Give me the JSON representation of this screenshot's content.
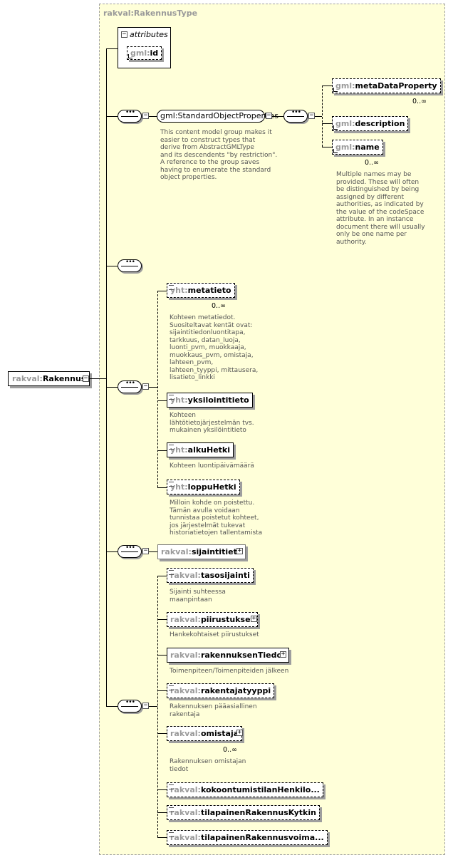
{
  "type_name": "rakval:RakennusType",
  "root": {
    "prefix": "rakval:",
    "name": "Rakennus"
  },
  "attributes": {
    "header": "attributes",
    "id": {
      "prefix": "gml:",
      "name": "id"
    }
  },
  "std_group": {
    "name": "gml:StandardObjectProperties",
    "note": [
      "This content model group makes it",
      "easier to construct types that",
      "    derive from AbstractGMLType",
      "and its descendents \"by restriction\".",
      "    A reference to the group saves",
      "having to enumerate the standard",
      "object properties."
    ],
    "items": [
      {
        "prefix": "gml:",
        "name": "metaDataProperty",
        "card": "0..∞"
      },
      {
        "prefix": "gml:",
        "name": "description",
        "card": ""
      },
      {
        "prefix": "gml:",
        "name": "name",
        "card": "0..∞"
      }
    ],
    "name_note": [
      "Multiple names may be",
      "provided.  These will often",
      "be distinguished by being",
      "assigned by different",
      "authorities, as indicated by",
      "the value of the codeSpace",
      "attribute.  In an instance",
      "document there will usually",
      "only be one name per",
      "authority."
    ]
  },
  "yht": [
    {
      "prefix": "yht:",
      "name": "metatieto",
      "card": "0..∞",
      "note": [
        "Kohteen metatiedot.",
        "Suositeltavat kentät ovat:",
        "sijaintitiedonluontitapa,",
        "tarkkuus, datan_luoja,",
        "luonti_pvm, muokkaaja,",
        "muokkaus_pvm, omistaja,",
        "lahteen_pvm,",
        "lahteen_tyyppi, mittausera,",
        "lisatieto_linkki"
      ]
    },
    {
      "prefix": "yht:",
      "name": "yksilointitieto",
      "card": "",
      "note": [
        "Kohteen",
        "lähtötietojärjestelmän  tvs.",
        "mukainen yksilöintitieto"
      ]
    },
    {
      "prefix": "yht:",
      "name": "alkuHetki",
      "card": "",
      "note": [
        "Kohteen luontipäivämäärä"
      ]
    },
    {
      "prefix": "yht:",
      "name": "loppuHetki",
      "card": "",
      "note": [
        "Milloin kohde on poistettu.",
        "Tämän avulla voidaan",
        "tunnistaa poistetut kohteet,",
        "jos järjestelmät tukevat",
        "historiatietojen tallentamista"
      ]
    }
  ],
  "sijainti": {
    "prefix": "rakval:",
    "name": "sijaintitieto"
  },
  "rakval": [
    {
      "prefix": "rakval:",
      "name": "tasosijainti",
      "card": "",
      "note": [
        "Sijainti suhteessa",
        "maanpintaan"
      ]
    },
    {
      "prefix": "rakval:",
      "name": "piirustukset",
      "card": "",
      "note": [
        "Hankekohtaiset piirustukset"
      ]
    },
    {
      "prefix": "rakval:",
      "name": "rakennuksenTiedot",
      "card": "",
      "note": [
        "Toimenpiteen/Toimenpiteiden jälkeen"
      ]
    },
    {
      "prefix": "rakval:",
      "name": "rakentajatyyppi",
      "card": "",
      "note": [
        "Rakennuksen pääasiallinen",
        "rakentaja"
      ]
    },
    {
      "prefix": "rakval:",
      "name": "omistaja",
      "card": "0..∞",
      "note": [
        "Rakennuksen omistajan",
        "tiedot"
      ]
    },
    {
      "prefix": "rakval:",
      "name": "kokoontumistilanHenkilo...",
      "card": "",
      "note": []
    },
    {
      "prefix": "rakval:",
      "name": "tilapainenRakennusKytkin",
      "card": "",
      "note": []
    },
    {
      "prefix": "rakval:",
      "name": "tilapainenRakennusvoima...",
      "card": "",
      "note": []
    }
  ]
}
